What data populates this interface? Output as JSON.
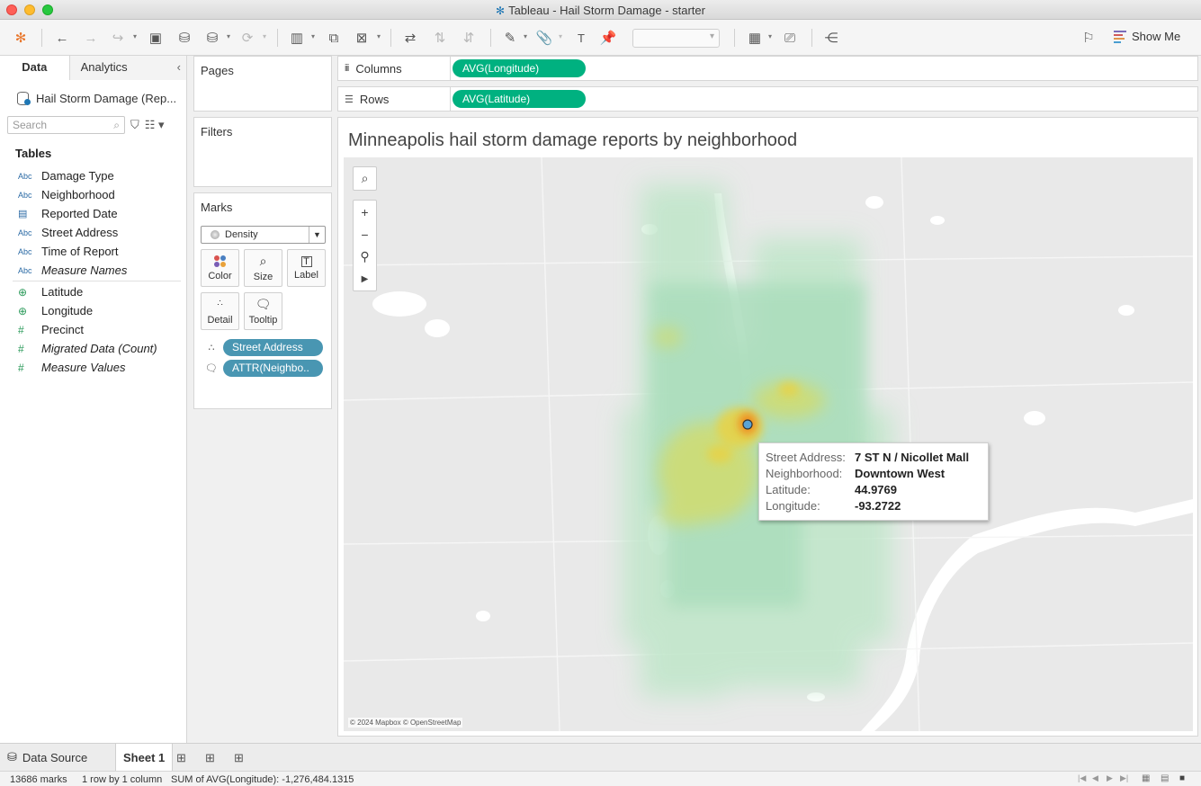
{
  "window": {
    "title": "Tableau - Hail Storm Damage - starter"
  },
  "toolbar": {
    "show_me": "Show Me"
  },
  "datapane": {
    "tabs": [
      {
        "label": "Data"
      },
      {
        "label": "Analytics"
      }
    ],
    "source": "Hail Storm Damage (Rep...",
    "search_placeholder": "Search",
    "tables_heading": "Tables",
    "fields": [
      {
        "type": "Abc",
        "name": "Damage Type"
      },
      {
        "type": "Abc",
        "name": "Neighborhood"
      },
      {
        "type": "date",
        "name": "Reported Date"
      },
      {
        "type": "Abc",
        "name": "Street Address"
      },
      {
        "type": "Abc",
        "name": "Time of Report"
      },
      {
        "type": "Abc",
        "name": "Measure Names"
      },
      {
        "type": "geo",
        "name": "Latitude"
      },
      {
        "type": "geo",
        "name": "Longitude"
      },
      {
        "type": "#",
        "name": "Precinct"
      },
      {
        "type": "#",
        "name": "Migrated Data (Count)"
      },
      {
        "type": "#",
        "name": "Measure Values"
      }
    ]
  },
  "cards": {
    "pages": "Pages",
    "filters": "Filters",
    "marks": {
      "title": "Marks",
      "type": "Density",
      "buttons": {
        "color": "Color",
        "size": "Size",
        "label": "Label",
        "detail": "Detail",
        "tooltip": "Tooltip"
      },
      "pills": [
        "Street Address",
        "ATTR(Neighbo.."
      ]
    }
  },
  "shelves": {
    "columns": {
      "label": "Columns",
      "pill": "AVG(Longitude)"
    },
    "rows": {
      "label": "Rows",
      "pill": "AVG(Latitude)"
    }
  },
  "viz": {
    "title": "Minneapolis hail storm damage reports by neighborhood",
    "credit": "© 2024 Mapbox © OpenStreetMap",
    "tooltip": [
      {
        "key": "Street Address:",
        "value": "7 ST N / Nicollet Mall"
      },
      {
        "key": "Neighborhood:",
        "value": "Downtown West"
      },
      {
        "key": "Latitude:",
        "value": "44.9769"
      },
      {
        "key": "Longitude:",
        "value": "-93.2722"
      }
    ]
  },
  "sheets": {
    "data_source": "Data Source",
    "active": "Sheet 1"
  },
  "status": {
    "marks": "13686 marks",
    "dims": "1 row by 1 column",
    "sum": "SUM of AVG(Longitude): -1,276,484.1315"
  },
  "colors": {
    "pill_green": "#00b180",
    "pill_blue": "#4996b2",
    "density_low": "#a9ddbb",
    "density_mid": "#e3d74a",
    "density_high": "#f08a1e"
  }
}
